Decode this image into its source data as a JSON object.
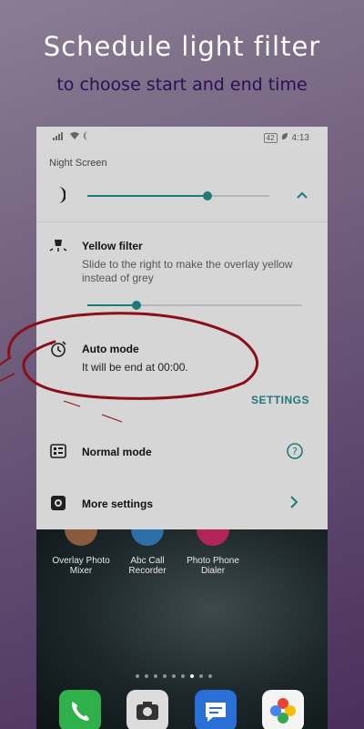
{
  "promo": {
    "title": "Schedule light filter",
    "subtitle": "to choose start and end time"
  },
  "status_bar": {
    "battery": "42",
    "time": "4:13"
  },
  "panel": {
    "app_name": "Night Screen",
    "intensity_level": 0.66,
    "yellow_filter": {
      "title": "Yellow filter",
      "description": "Slide to the right to make the overlay yellow instead of grey",
      "level": 0.23
    },
    "auto_mode": {
      "title": "Auto mode",
      "description": "It will be end at 00:00.",
      "settings_label": "SETTINGS"
    },
    "normal_mode": {
      "title": "Normal mode"
    },
    "more_settings": {
      "title": "More settings"
    }
  },
  "home_screen": {
    "apps": [
      "Overlay Photo Mixer",
      "Abc Call Recorder",
      "Photo Phone Dialer"
    ],
    "dock": [
      "phone-icon",
      "camera-icon",
      "messages-icon",
      "gallery-icon"
    ],
    "page_count": 9,
    "active_page": 7
  },
  "colors": {
    "accent": "#1e7a77",
    "panel_bg": "#d6d6d6",
    "annotation": "#8b0f1a"
  }
}
